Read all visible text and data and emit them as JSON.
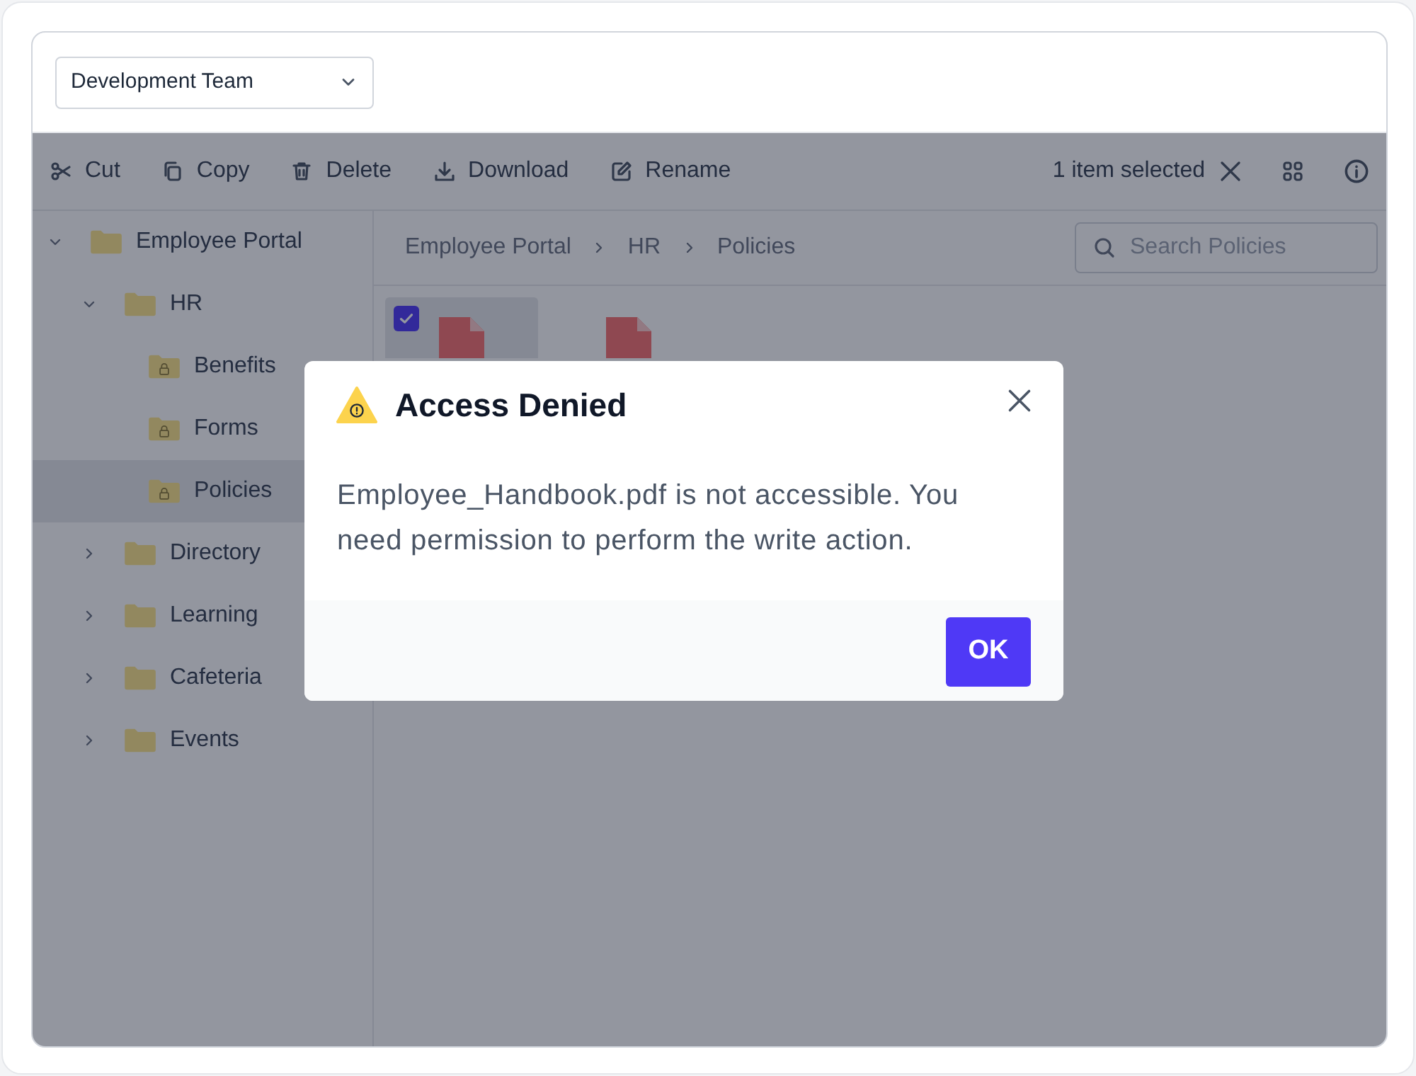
{
  "team_dropdown": {
    "value": "Development Team"
  },
  "toolbar": {
    "actions": [
      {
        "kind": "cut",
        "label": "Cut"
      },
      {
        "kind": "copy",
        "label": "Copy"
      },
      {
        "kind": "delete",
        "label": "Delete"
      },
      {
        "kind": "download",
        "label": "Download"
      },
      {
        "kind": "rename",
        "label": "Rename"
      }
    ],
    "selection_text": "1 item selected"
  },
  "tree": [
    {
      "label": "Employee Portal",
      "kind": "folder",
      "expanded": true,
      "selected": false,
      "children": [
        {
          "label": "HR",
          "kind": "folder",
          "expanded": true,
          "selected": false,
          "children": [
            {
              "label": "Benefits",
              "kind": "locked",
              "selected": false
            },
            {
              "label": "Forms",
              "kind": "locked",
              "selected": false
            },
            {
              "label": "Policies",
              "kind": "locked",
              "selected": true
            }
          ]
        },
        {
          "label": "Directory",
          "kind": "folder",
          "expanded": false,
          "selected": false
        },
        {
          "label": "Learning",
          "kind": "folder",
          "expanded": false,
          "selected": false
        },
        {
          "label": "Cafeteria",
          "kind": "folder",
          "expanded": false,
          "selected": false
        },
        {
          "label": "Events",
          "kind": "folder",
          "expanded": false,
          "selected": false
        }
      ]
    }
  ],
  "breadcrumb": [
    "Employee Portal",
    "HR",
    "Policies"
  ],
  "search": {
    "placeholder": "Search Policies"
  },
  "files": [
    {
      "kind": "pdf",
      "selected": true
    },
    {
      "kind": "pdf",
      "selected": false
    }
  ],
  "dialog": {
    "title": "Access Denied",
    "message": "Employee_Handbook.pdf is not accessible. You need permission to perform the write action.",
    "button": "OK"
  }
}
